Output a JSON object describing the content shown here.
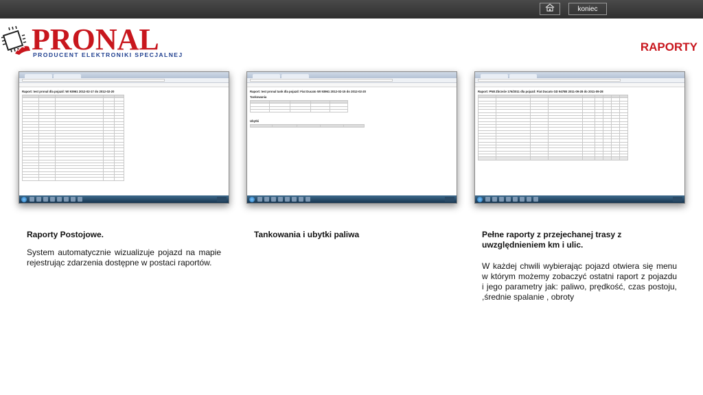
{
  "header": {
    "home_icon": "home-icon",
    "exit_label": "koniec"
  },
  "brand": {
    "name": "PRONAL",
    "tagline": "PRODUCENT ELEKTRONIKI SPECJALNEJ",
    "color": "#c8161d",
    "tagline_color": "#1f3f8f"
  },
  "page": {
    "title": "RAPORTY"
  },
  "screenshots": [
    {
      "report_title": "Raport: test pronal dla pojazd: WI 93961 2012-02-17 do 2012-02-20"
    },
    {
      "report_title": "Raport: test pronal tank dla pojazd: Fiat Ducato WI 93961 2012-02-15 do 2012-02-20",
      "section_1": "Tankowania",
      "section_2": "Ubytki"
    },
    {
      "report_title": "Raport: PN8 Zbrzeże 176/2011 dla pojazd: Fiat Ducato GD 9478E 2011-09-28 do 2011-09-28"
    }
  ],
  "captions": [
    {
      "heading": "Raporty Postojowe.",
      "body": "System automatycznie wizualizuje pojazd na mapie rejestrując zdarzenia dostępne w postaci raportów."
    },
    {
      "heading": "Tankowania i ubytki paliwa",
      "body": ""
    },
    {
      "heading": "Pełne raporty z przejechanej trasy z uwzględnieniem km i ulic.",
      "body": "W każdej chwili wybierając pojazd otwiera się menu w którym możemy zobaczyć ostatni raport z pojazdu i jego parametry jak: paliwo, prędkość, czas postoju, ,średnie spalanie , obroty"
    }
  ]
}
